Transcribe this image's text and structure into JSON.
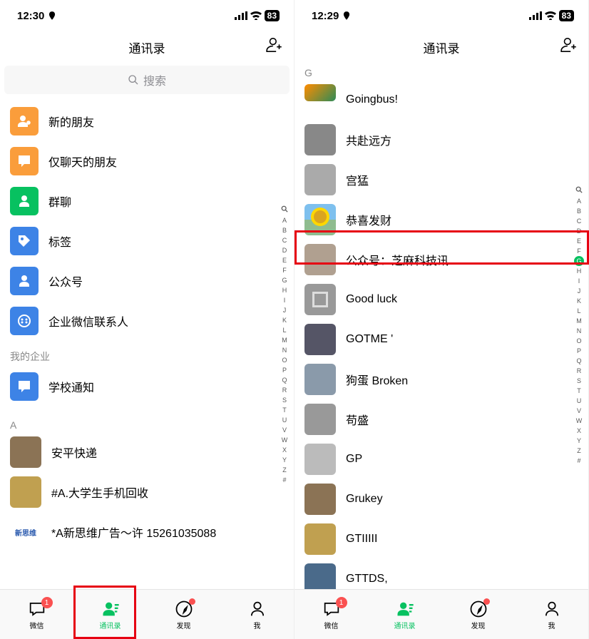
{
  "left": {
    "time": "12:30",
    "battery": "83",
    "header_title": "通讯录",
    "search_placeholder": "搜索",
    "fn_items": [
      {
        "label": "新的朋友",
        "color": "#fa9d3b"
      },
      {
        "label": "仅聊天的朋友",
        "color": "#fa9d3b"
      },
      {
        "label": "群聊",
        "color": "#07C160"
      },
      {
        "label": "标签",
        "color": "#3d83e6"
      },
      {
        "label": "公众号",
        "color": "#3d83e6"
      },
      {
        "label": "企业微信联系人",
        "color": "#3d83e6"
      }
    ],
    "section_label": "我的企业",
    "enterprise": [
      {
        "label": "学校通知",
        "color": "#3d83e6"
      }
    ],
    "index_a": "A",
    "contacts_a": [
      {
        "name": "安平快递"
      },
      {
        "name": "#A.大学生手机回收"
      },
      {
        "name": "*A新思维广告～许 15261035088"
      }
    ],
    "index_letters": [
      "Q",
      "A",
      "B",
      "C",
      "D",
      "E",
      "F",
      "G",
      "H",
      "I",
      "J",
      "K",
      "L",
      "M",
      "N",
      "O",
      "P",
      "Q",
      "R",
      "S",
      "T",
      "U",
      "V",
      "W",
      "X",
      "Y",
      "Z",
      "#"
    ]
  },
  "right": {
    "time": "12:29",
    "battery": "83",
    "header_title": "通讯录",
    "index_g": "G",
    "contacts": [
      {
        "name": "Goingbus!"
      },
      {
        "name": "共赴远方"
      },
      {
        "name": "宫猛"
      },
      {
        "name": "恭喜发财"
      },
      {
        "name": "公众号：芝麻科技讯"
      },
      {
        "name": "Good luck"
      },
      {
        "name": "GOTME '"
      },
      {
        "name": "狗蛋 Broken"
      },
      {
        "name": "苟盛"
      },
      {
        "name": "GP"
      },
      {
        "name": "Grukey"
      },
      {
        "name": "GTIIIII"
      },
      {
        "name": "GTTDS,"
      }
    ],
    "index_letters": [
      "Q",
      "A",
      "B",
      "C",
      "D",
      "E",
      "F",
      "G",
      "H",
      "I",
      "J",
      "K",
      "L",
      "M",
      "N",
      "O",
      "P",
      "Q",
      "R",
      "S",
      "T",
      "U",
      "V",
      "W",
      "X",
      "Y",
      "Z",
      "#"
    ],
    "active_index": "G"
  },
  "tabs": [
    {
      "label": "微信",
      "badge": "1"
    },
    {
      "label": "通讯录"
    },
    {
      "label": "发现",
      "dot": true
    },
    {
      "label": "我"
    }
  ]
}
